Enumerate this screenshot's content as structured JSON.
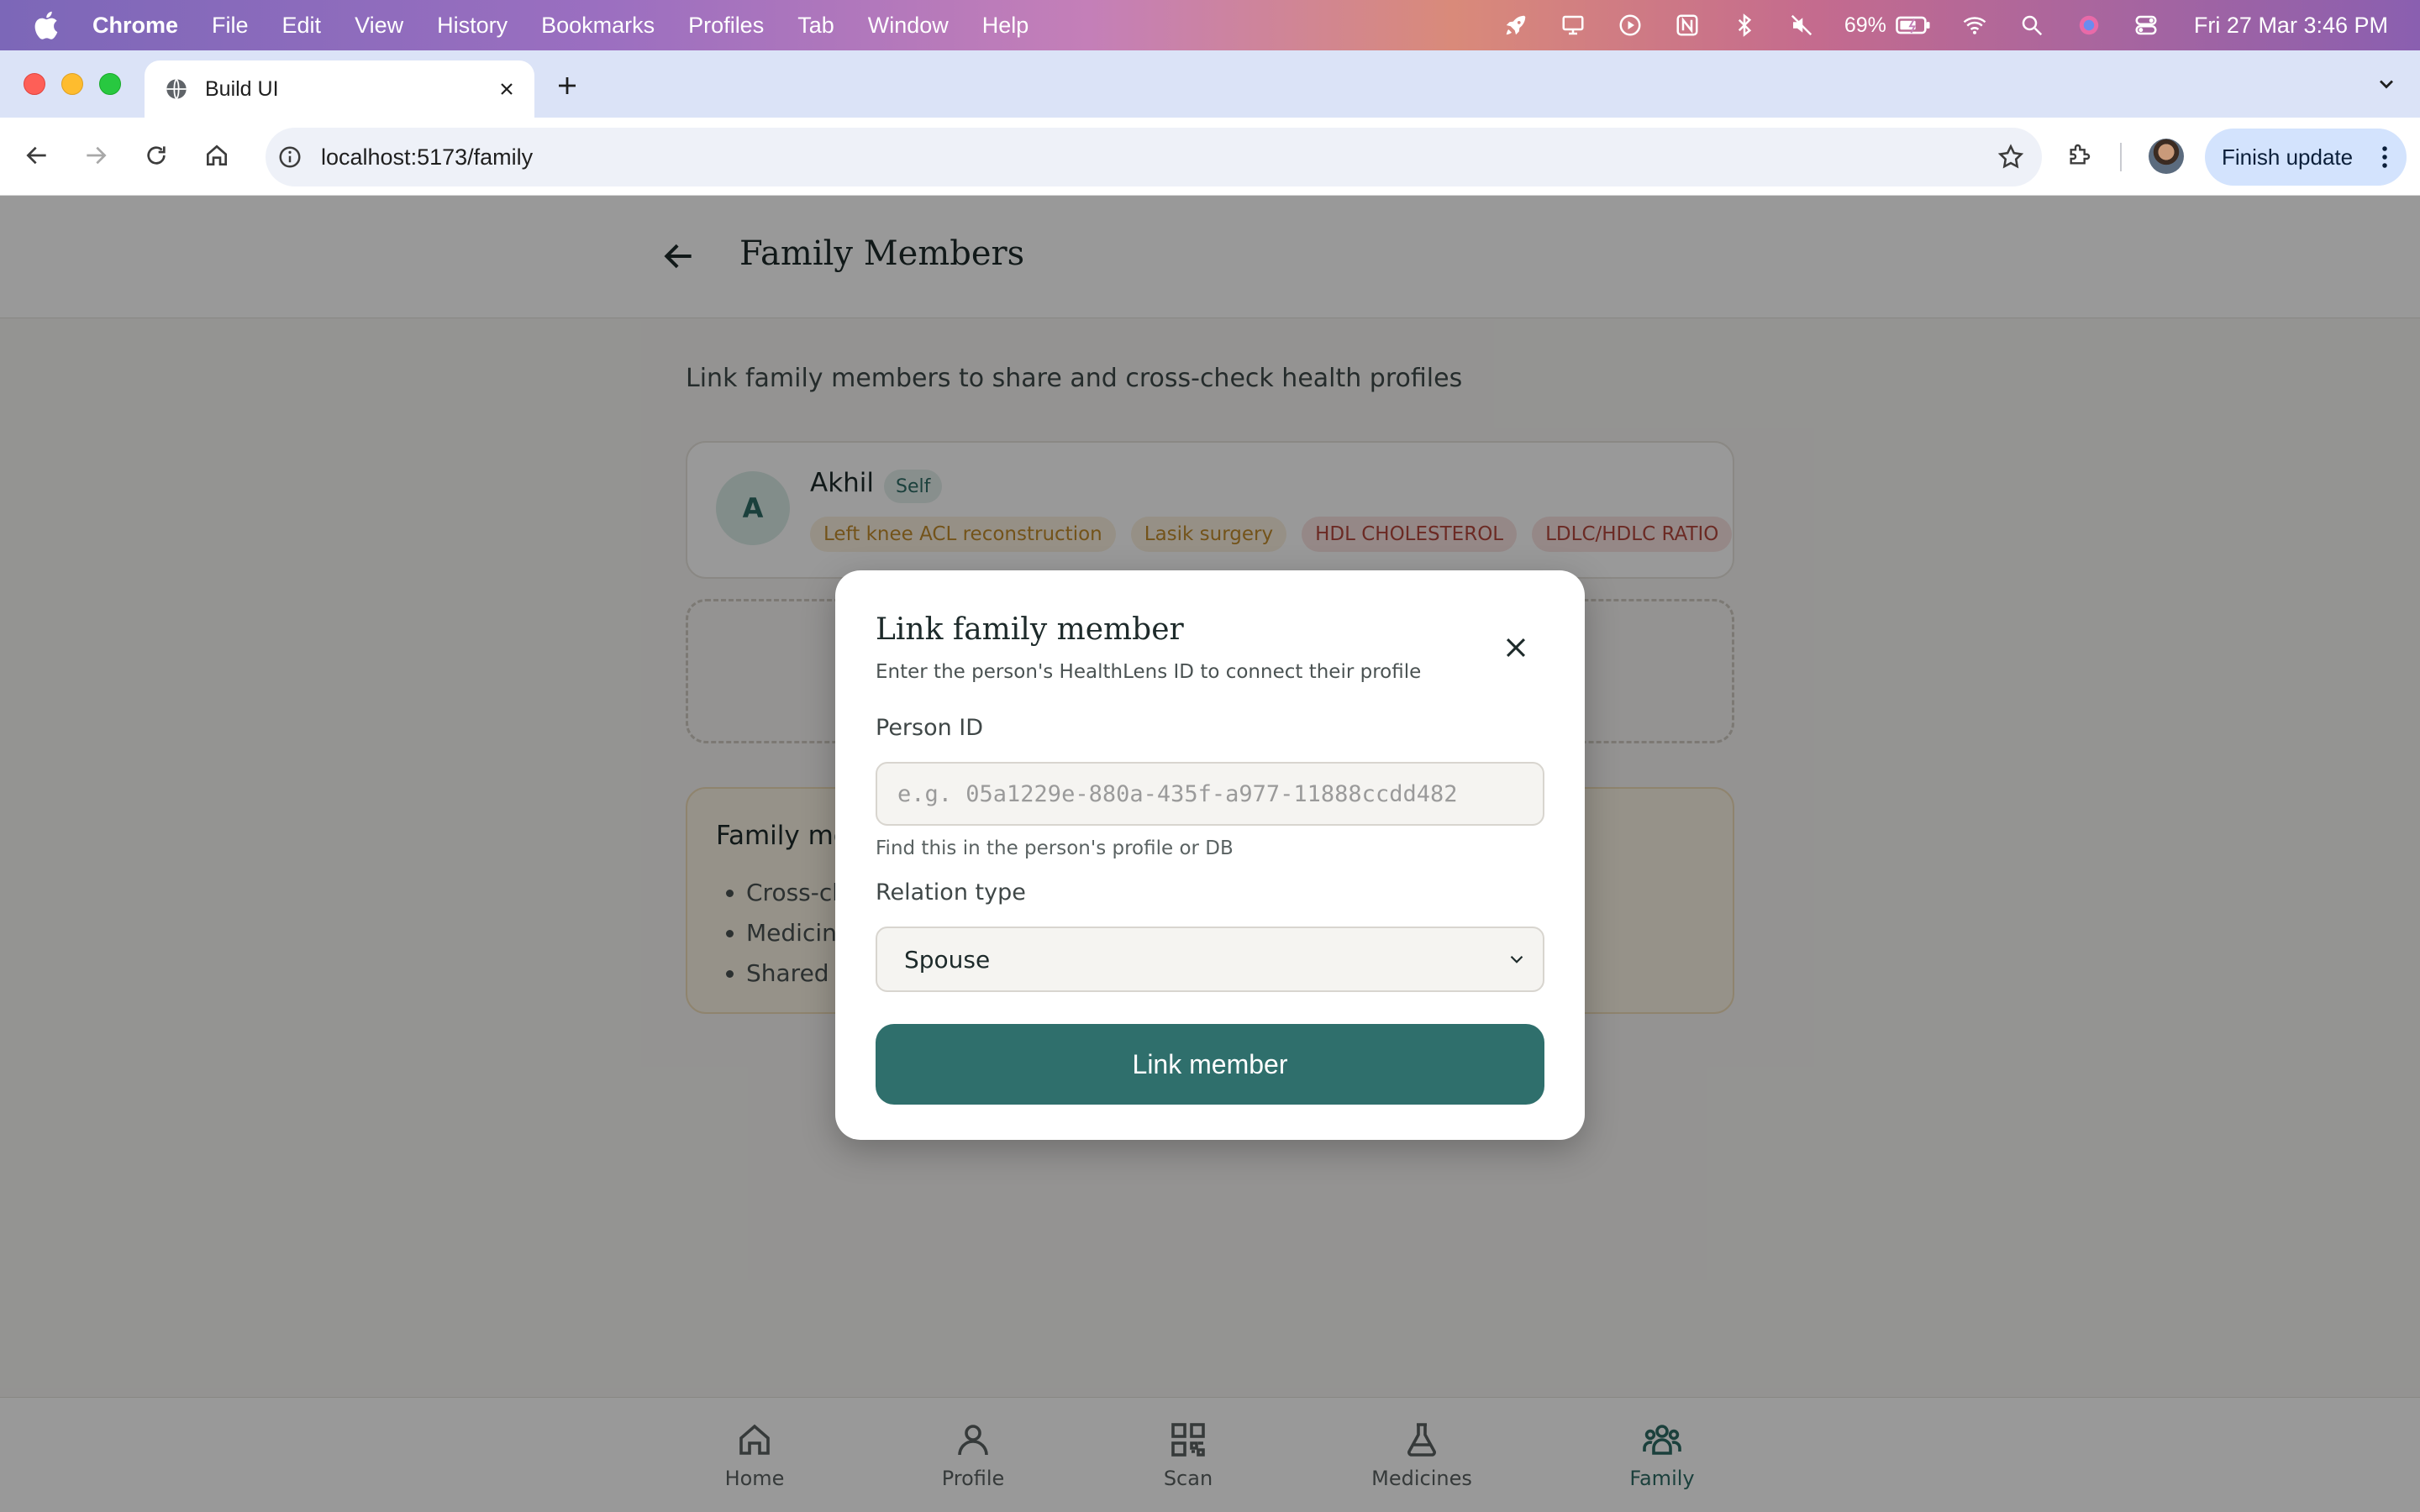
{
  "menubar": {
    "app_name": "Chrome",
    "items": [
      "File",
      "Edit",
      "View",
      "History",
      "Bookmarks",
      "Profiles",
      "Tab",
      "Window",
      "Help"
    ],
    "battery": "69%",
    "datetime": "Fri 27 Mar  3:46 PM"
  },
  "browser": {
    "tab_title": "Build UI",
    "url": "localhost:5173/family",
    "finish_update_label": "Finish update"
  },
  "page": {
    "title": "Family Members",
    "subtitle": "Link family members to share and cross-check health profiles",
    "self_member": {
      "initial": "A",
      "name": "Akhil",
      "badge": "Self",
      "tags": [
        {
          "label": "Left knee ACL reconstruction",
          "tone": "amber"
        },
        {
          "label": "Lasik surgery",
          "tone": "amber"
        },
        {
          "label": "HDL CHOLESTEROL",
          "tone": "red"
        },
        {
          "label": "LDLC/HDLC RATIO",
          "tone": "red"
        }
      ]
    },
    "info_card": {
      "title": "Family mo",
      "items": [
        "Cross-ch",
        "Medicine",
        "Shared c"
      ]
    }
  },
  "bottom_nav": [
    {
      "label": "Home",
      "icon": "home-icon",
      "active": false
    },
    {
      "label": "Profile",
      "icon": "person-icon",
      "active": false
    },
    {
      "label": "Scan",
      "icon": "qr-scan-icon",
      "active": false
    },
    {
      "label": "Medicines",
      "icon": "flask-icon",
      "active": false
    },
    {
      "label": "Family",
      "icon": "family-icon",
      "active": true
    }
  ],
  "modal": {
    "title": "Link family member",
    "subtitle": "Enter the person's HealthLens ID to connect their profile",
    "person_id_label": "Person ID",
    "person_id_value": "",
    "person_id_placeholder": "e.g. 05a1229e-880a-435f-a977-11888ccdd482",
    "person_id_hint": "Find this in the person's profile or DB",
    "relation_label": "Relation type",
    "relation_value": "Spouse",
    "submit_label": "Link member"
  },
  "colors": {
    "brand_teal": "#2f6f6c",
    "amber_tag_text": "#c08a2c",
    "red_tag_text": "#b3463d"
  }
}
